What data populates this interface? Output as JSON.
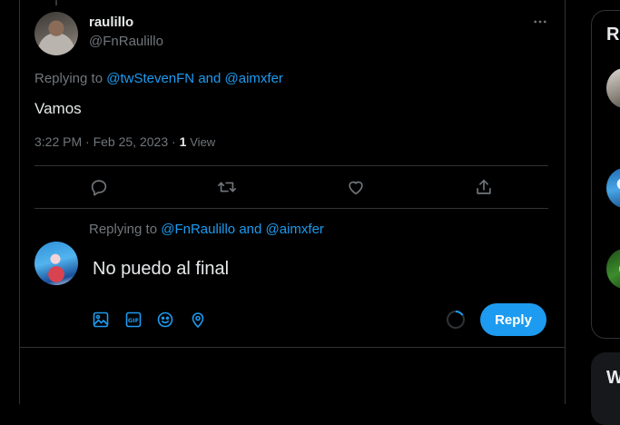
{
  "tweet": {
    "author_name": "raulillo",
    "author_handle": "@FnRaulillo",
    "replying_prefix": "Replying to",
    "replying_to_1": "@twStevenFN",
    "replying_and": "and",
    "replying_to_2": "@aimxfer",
    "text": "Vamos",
    "time": "3:22 PM",
    "separator": "·",
    "date": "Feb 25, 2023",
    "views_count": "1",
    "views_label": "View"
  },
  "actions": {
    "reply_icon": "comment-icon",
    "retweet_icon": "retweet-icon",
    "like_icon": "heart-icon",
    "share_icon": "share-icon"
  },
  "composer": {
    "replying_prefix": "Replying to",
    "replying_to_1": "@FnRaulillo",
    "replying_and": "and",
    "replying_to_2": "@aimxfer",
    "text": "No puedo al final",
    "reply_button": "Reply",
    "tools": [
      "image-icon",
      "gif-icon",
      "emoji-icon",
      "location-icon"
    ]
  },
  "sidebar": {
    "card1_title": "R",
    "card2_title": "W"
  },
  "colors": {
    "accent": "#1d9bf0",
    "muted": "#71767b",
    "border": "#2f3336"
  }
}
